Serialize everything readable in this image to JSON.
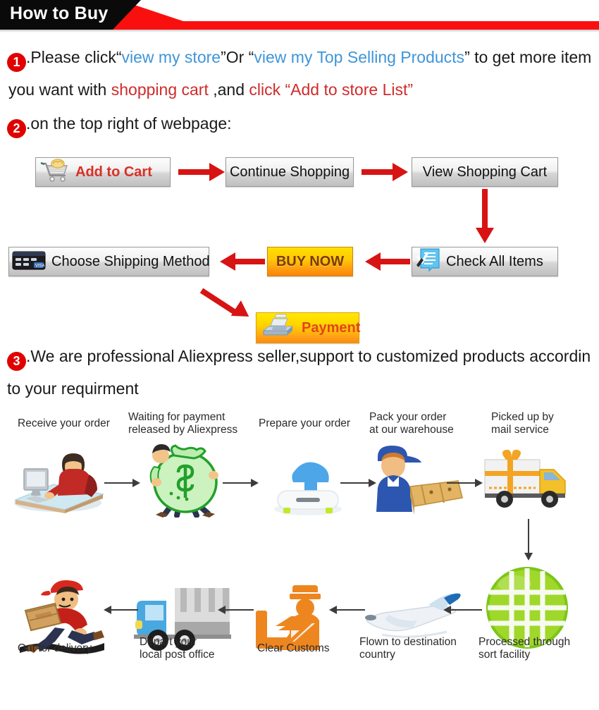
{
  "header": {
    "title": "How to Buy",
    "black_color": "#0a0a0a",
    "red_color": "#fa0f0f"
  },
  "steps": [
    {
      "number": "1",
      "line1": {
        "t1": ".Please click“",
        "link1": "view my store",
        "t2": "”Or “",
        "link2": "view my Top Selling Products",
        "t3": "” to get more item"
      },
      "line2": {
        "t1": "you want with ",
        "em1": "shopping cart",
        "t2": " ,and ",
        "em2": "click “Add to store List”"
      }
    },
    {
      "number": "2",
      "line1": ".on the top right of webpage:"
    },
    {
      "number": "3",
      "line1": ".We are professional Aliexpress seller,support to customized products accordin",
      "line2": "to your requirment"
    }
  ],
  "flow": {
    "buttons": [
      {
        "id": "add-cart",
        "label": "Add to Cart",
        "icon": "shopping-cart-icon"
      },
      {
        "id": "continue",
        "label": "Continue Shopping",
        "icon": "none"
      },
      {
        "id": "view-cart",
        "label": "View Shopping Cart",
        "icon": "none"
      },
      {
        "id": "shipping",
        "label": "Choose Shipping Method",
        "icon": "credit-card-icon"
      },
      {
        "id": "buynow",
        "label": "BUY NOW",
        "icon": "none"
      },
      {
        "id": "check",
        "label": "Check All Items",
        "icon": "checklist-icon"
      },
      {
        "id": "payment",
        "label": "Payment",
        "icon": "cash-register-icon"
      }
    ],
    "arrow_color": "#d81313"
  },
  "process": {
    "row1": [
      {
        "caption": "Receive your order",
        "icon": "person-at-computer-icon"
      },
      {
        "caption": "Waiting for payment\nreleased by Aliexpress",
        "icon": "money-bag-icon"
      },
      {
        "caption": "Prepare your order",
        "icon": "download-box-icon"
      },
      {
        "caption": "Pack your order\nat our warehouse",
        "icon": "warehouse-worker-icon"
      },
      {
        "caption": "Picked up by\nmail service",
        "icon": "delivery-truck-icon"
      }
    ],
    "row2": [
      {
        "caption": "Out for delivery",
        "icon": "running-courier-icon"
      },
      {
        "caption": "Depart your\nlocal post office",
        "icon": "post-truck-icon"
      },
      {
        "caption": "Clear Customs",
        "icon": "customs-officer-icon"
      },
      {
        "caption": "Flown to destination\ncountry",
        "icon": "airplane-icon"
      },
      {
        "caption": "Processed through\nsort facility",
        "icon": "green-globe-icon"
      }
    ],
    "arrow_color": "#3c3c3c"
  }
}
